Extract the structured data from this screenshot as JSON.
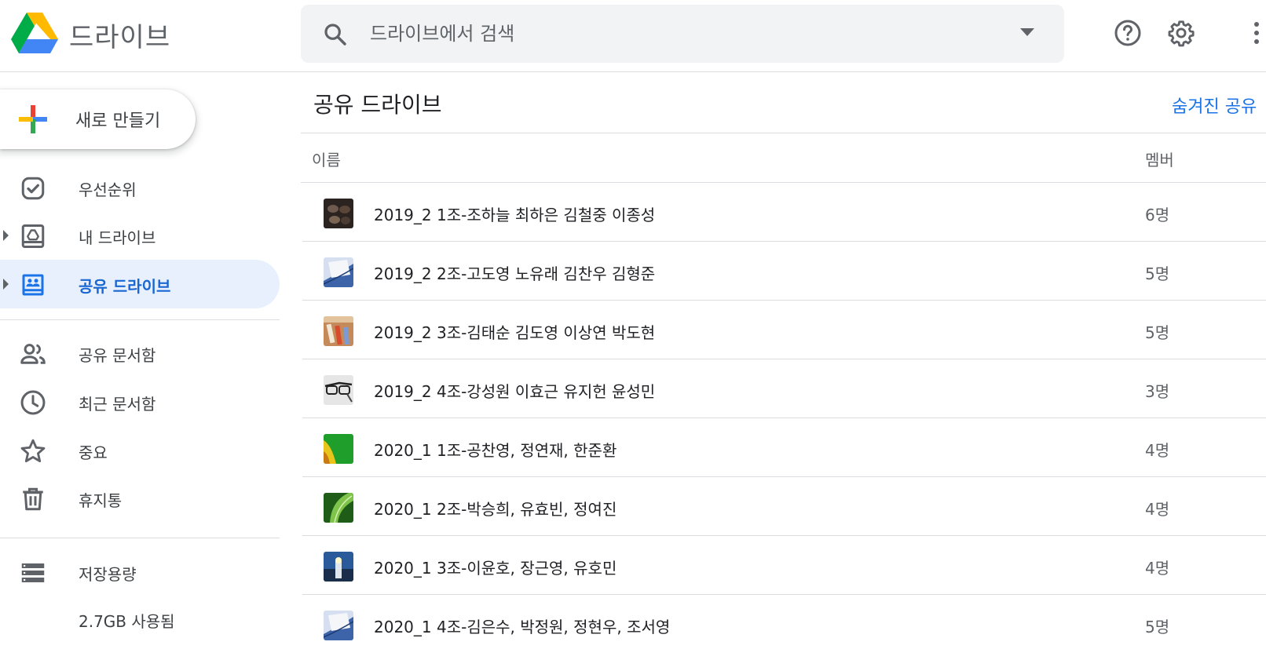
{
  "header": {
    "app_title": "드라이브",
    "search_placeholder": "드라이브에서 검색"
  },
  "sidebar": {
    "new_label": "새로 만들기",
    "items": [
      {
        "label": "우선순위",
        "icon": "priority-icon"
      },
      {
        "label": "내 드라이브",
        "icon": "my-drive-icon"
      },
      {
        "label": "공유 드라이브",
        "icon": "shared-drives-icon",
        "active": true
      },
      {
        "label": "공유 문서함",
        "icon": "people-icon"
      },
      {
        "label": "최근 문서함",
        "icon": "clock-icon"
      },
      {
        "label": "중요",
        "icon": "star-icon"
      },
      {
        "label": "휴지통",
        "icon": "trash-icon"
      },
      {
        "label": "저장용량",
        "icon": "storage-icon"
      }
    ],
    "storage_used": "2.7GB 사용됨"
  },
  "main": {
    "title": "공유 드라이브",
    "hidden_link": "숨겨진 공유",
    "columns": {
      "name": "이름",
      "members": "멤버"
    },
    "rows": [
      {
        "name": "2019_2 1조-조하늘 최하은 김철중 이종성",
        "members": "6명",
        "thumb": "dark-rope"
      },
      {
        "name": "2019_2 2조-고도영 노유래 김찬우 김형준",
        "members": "5명",
        "thumb": "blue-page"
      },
      {
        "name": "2019_2 3조-김태순 김도영 이상연 박도현",
        "members": "5명",
        "thumb": "pencils"
      },
      {
        "name": "2019_2 4조-강성원 이효근 유지헌 윤성민",
        "members": "3명",
        "thumb": "glasses"
      },
      {
        "name": "2020_1 1조-공찬영, 정연재, 한준환",
        "members": "4명",
        "thumb": "green-yellow"
      },
      {
        "name": "2020_1 2조-박승희, 유효빈, 정여진",
        "members": "4명",
        "thumb": "leaf"
      },
      {
        "name": "2020_1 3조-이윤호, 장근영, 유호민",
        "members": "4명",
        "thumb": "lighthouse"
      },
      {
        "name": "2020_1 4조-김은수, 박정원, 정현우, 조서영",
        "members": "5명",
        "thumb": "blue-page"
      }
    ]
  },
  "colors": {
    "accent": "#1a73e8",
    "active_bg": "#e8f0fe",
    "divider": "#dadce0"
  }
}
